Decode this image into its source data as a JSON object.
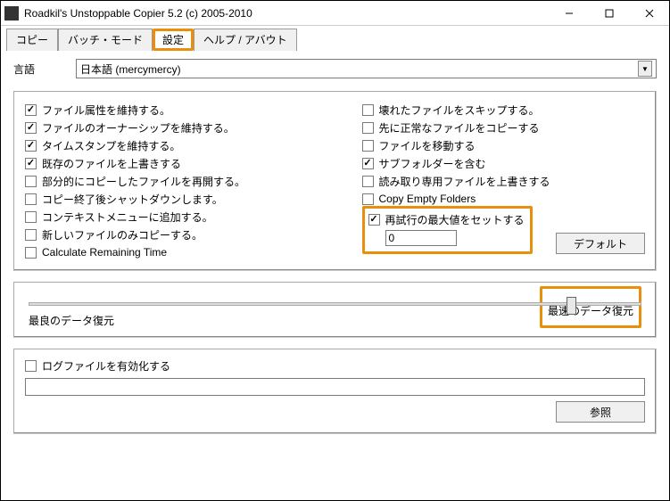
{
  "window": {
    "title": "Roadkil's Unstoppable Copier 5.2 (c) 2005-2010"
  },
  "tabs": {
    "copy": "コピー",
    "batch": "バッチ・モード",
    "settings": "設定",
    "help": "ヘルプ / アバウト"
  },
  "language": {
    "label": "言語",
    "selected": "日本語 (mercymercy)"
  },
  "checks_left": [
    {
      "label": "ファイル属性を維持する。",
      "checked": true
    },
    {
      "label": "ファイルのオーナーシップを維持する。",
      "checked": true
    },
    {
      "label": "タイムスタンプを維持する。",
      "checked": true
    },
    {
      "label": "既存のファイルを上書きする",
      "checked": true
    },
    {
      "label": "部分的にコピーしたファイルを再開する。",
      "checked": false
    },
    {
      "label": "コピー終了後シャットダウンします。",
      "checked": false
    },
    {
      "label": "コンテキストメニューに追加する。",
      "checked": false
    },
    {
      "label": "新しいファイルのみコピーする。",
      "checked": false
    },
    {
      "label": "Calculate Remaining Time",
      "checked": false
    }
  ],
  "checks_right": [
    {
      "label": "壊れたファイルをスキップする。",
      "checked": false
    },
    {
      "label": "先に正常なファイルをコピーする",
      "checked": false
    },
    {
      "label": "ファイルを移動する",
      "checked": false
    },
    {
      "label": "サブフォルダーを含む",
      "checked": true
    },
    {
      "label": "読み取り専用ファイルを上書きする",
      "checked": false
    },
    {
      "label": "Copy Empty Folders",
      "checked": false
    }
  ],
  "max_retry": {
    "label": "再試行の最大値をセットする",
    "checked": true,
    "value": "0"
  },
  "buttons": {
    "default": "デフォルト",
    "browse": "参照"
  },
  "recovery": {
    "left_label": "最良のデータ復元",
    "right_label": "最速のデータ復元"
  },
  "log": {
    "enable_label": "ログファイルを有効化する",
    "checked": false,
    "path": ""
  }
}
